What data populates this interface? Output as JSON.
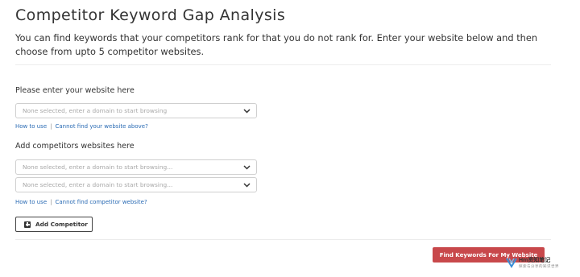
{
  "page": {
    "title": "Competitor Keyword Gap Analysis",
    "description": "You can find keywords that your competitors rank for that you do not rank for. Enter your website below and then choose from upto 5 competitor websites."
  },
  "website_section": {
    "label": "Please enter your website here",
    "select_placeholder": "None selected, enter a domain to start browsing",
    "link_how_to_use": "How to use",
    "separator": "|",
    "link_cannot_find": "Cannot find your website above?"
  },
  "competitors_section": {
    "label": "Add competitors websites here",
    "selects": [
      {
        "placeholder": "None selected, enter a domain to start browsing..."
      },
      {
        "placeholder": "None selected, enter a domain to start browsing..."
      }
    ],
    "link_how_to_use": "How to use",
    "separator": "|",
    "link_cannot_find": "Cannot find competitor website?",
    "add_button_label": "Add Competitor"
  },
  "actions": {
    "find_button_label": "Find Keywords For My Website"
  },
  "watermark": {
    "line1": "Hm资知笔记",
    "line2": "探索与分享的知识世界"
  },
  "colors": {
    "accent": "#c8484b",
    "link": "#2a6bb4",
    "border": "#cfcfcf"
  },
  "icons": {
    "dropdown": "chevron-down-icon",
    "add": "plus-square-icon"
  }
}
